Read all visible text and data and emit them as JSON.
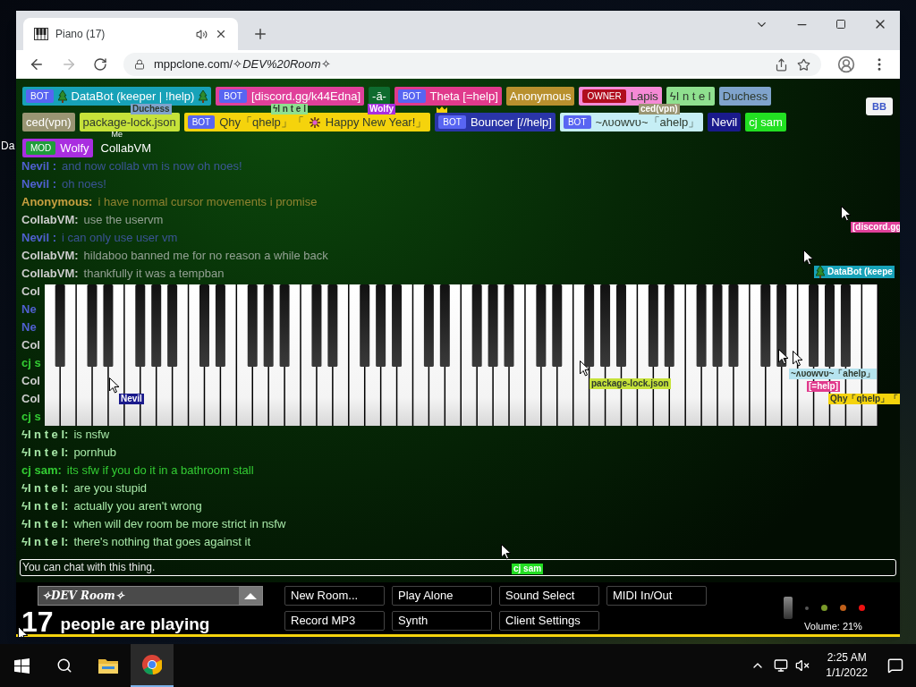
{
  "browser": {
    "tab_title": "Piano (17)",
    "address": "mppclone.com/✧*DEV%20Room*✧"
  },
  "desktop_fragment": "Da",
  "user_rows": [
    [
      {
        "color": "#17a2b8",
        "badge": {
          "text": "BOT",
          "color": "#5865f2"
        },
        "parts": [
          {
            "kind": "tree"
          },
          {
            "kind": "text",
            "text": "DataBot (keeper | !help)"
          },
          {
            "kind": "tree"
          }
        ]
      },
      {
        "color": "#e0409a",
        "badge": {
          "text": "BOT",
          "color": "#5865f2"
        },
        "parts": [
          {
            "kind": "text",
            "text": "[discord.gg/k44Edna]"
          }
        ]
      },
      {
        "color": "#0e6b2e",
        "parts": [
          {
            "kind": "text",
            "text": "-ā-"
          }
        ]
      },
      {
        "color": "#e03a8c",
        "badge": {
          "text": "BOT",
          "color": "#5865f2"
        },
        "parts": [
          {
            "kind": "text",
            "text": "Theta [=help]"
          }
        ]
      },
      {
        "color": "#b8902e",
        "parts": [
          {
            "kind": "text",
            "text": "Anonymous"
          }
        ]
      },
      {
        "color": "#f58ad6",
        "badge": {
          "text": "OWNER",
          "color": "#b00e1e"
        },
        "parts": [
          {
            "kind": "text",
            "text": "Lapis"
          }
        ]
      },
      {
        "color": "#8fe08f",
        "parts": [
          {
            "kind": "text",
            "text": "ϟI n t e l"
          }
        ]
      },
      {
        "color": "#7fa3cc",
        "parts": [
          {
            "kind": "text",
            "text": "Duchess"
          }
        ]
      }
    ],
    [
      {
        "color": "#9a9573",
        "parts": [
          {
            "kind": "text",
            "text": "ced(vpn)"
          }
        ]
      },
      {
        "color": "#c6e23a",
        "parts": [
          {
            "kind": "text",
            "text": "package-lock.json"
          }
        ]
      },
      {
        "color": "#f5d30c",
        "badge": {
          "text": "BOT",
          "color": "#5865f2"
        },
        "parts": [
          {
            "kind": "text",
            "text": "Qhy「qhelp」「"
          },
          {
            "kind": "firework"
          },
          {
            "kind": "text",
            "text": "Happy New Year!」"
          }
        ]
      },
      {
        "color": "#2a35a8",
        "crown": true,
        "badge": {
          "text": "BOT",
          "color": "#5865f2"
        },
        "parts": [
          {
            "kind": "text",
            "text": "Bouncer [//help]"
          }
        ]
      },
      {
        "color": "#c6eef5",
        "badge": {
          "text": "BOT",
          "color": "#5865f2"
        },
        "parts": [
          {
            "kind": "text",
            "text": "~ᴧᴜᴏᴡᴠᴜ~「ahelp」"
          }
        ]
      },
      {
        "color": "#1a1a8c",
        "parts": [
          {
            "kind": "text",
            "text": "Nevil"
          }
        ]
      },
      {
        "color": "#22e022",
        "parts": [
          {
            "kind": "text",
            "text": "cj sam"
          }
        ]
      }
    ],
    [
      {
        "color": "#a92ee0",
        "badge": {
          "text": "MOD",
          "color": "#1f9c3a"
        },
        "parts": [
          {
            "kind": "text",
            "text": "Wolfy"
          }
        ]
      },
      {
        "me": "Me",
        "parts": [
          {
            "kind": "text",
            "text": "CollabVM"
          }
        ]
      }
    ]
  ],
  "menu_button": "BB",
  "chat": [
    {
      "name": "Nevil :",
      "text": "and now collab vm is now oh noes!",
      "color": "#5060d0",
      "faded": true
    },
    {
      "name": "Nevil :",
      "text": "oh noes!",
      "color": "#5060d0",
      "faded": true
    },
    {
      "name": "Anonymous:",
      "text": "i have normal cursor movements i promise",
      "color": "#c8a040",
      "faded": true
    },
    {
      "name": "CollabVM:",
      "text": "use the uservm",
      "color": "#cccccc",
      "faded": true
    },
    {
      "name": "Nevil :",
      "text": "i can only use user vm",
      "color": "#5060d0",
      "faded": true
    },
    {
      "name": "CollabVM:",
      "text": "hildaboo banned me for no reason a while back",
      "color": "#cccccc",
      "faded": true
    },
    {
      "name": "CollabVM:",
      "text": "thankfully it was a tempban",
      "color": "#cccccc",
      "faded": true
    },
    {
      "name": "Col",
      "color": "#cccccc"
    },
    {
      "name": "Ne",
      "color": "#5060d0"
    },
    {
      "name": "Ne",
      "color": "#5060d0"
    },
    {
      "name": "Col",
      "color": "#cccccc"
    },
    {
      "name": "cj s",
      "color": "#33cc33"
    },
    {
      "name": "Col",
      "color": "#cccccc"
    },
    {
      "name": "Col",
      "color": "#cccccc"
    },
    {
      "name": "cj s",
      "color": "#33cc33"
    },
    {
      "name": "ϟI n t e l:",
      "text": "is nsfw",
      "color": "#a8e8a8",
      "faded": false
    },
    {
      "name": "ϟI n t e l:",
      "text": "pornhub",
      "color": "#a8e8a8",
      "faded": false
    },
    {
      "name": "cj sam:",
      "text": "its sfw if you do it in a bathroom stall",
      "color": "#33cc33",
      "faded": false
    },
    {
      "name": "ϟI n t e l:",
      "text": "are you stupid",
      "color": "#a8e8a8",
      "faded": false
    },
    {
      "name": "ϟI n t e l:",
      "text": "actually you aren't wrong",
      "color": "#a8e8a8",
      "faded": false
    },
    {
      "name": "ϟI n t e l:",
      "text": "when will dev room be more strict in nsfw",
      "color": "#a8e8a8",
      "faded": false
    },
    {
      "name": "ϟI n t e l:",
      "text": "there's nothing that goes against it",
      "color": "#a8e8a8",
      "faded": false
    }
  ],
  "cursors": [
    {
      "kind": "tag",
      "tag": "Duchess",
      "color": "#7fa3cc"
    },
    {
      "kind": "tag",
      "tag": "ϟI n t e l",
      "color": "#8fe08f"
    },
    {
      "kind": "tag",
      "tag": "Wolfy",
      "color": "#a92ee0"
    },
    {
      "kind": "tag",
      "tag": "ced(vpn)",
      "color": "#9a9573"
    },
    {
      "kind": "tagged",
      "tag": "[discord.gg",
      "color": "#e0409a"
    },
    {
      "kind": "tagged",
      "tag": "DataBot (keepe",
      "color": "#17a2b8",
      "tree": true
    },
    {
      "kind": "tagged",
      "tag": "package-lock.json",
      "color": "#c6e23a"
    },
    {
      "kind": "tagged",
      "tag": "Nevil",
      "color": "#1a1a8c"
    },
    {
      "kind": "tagged",
      "tag": "~ᴧᴜᴏᴡᴠᴜ~「ahelp」",
      "color": "#b6e3ef"
    },
    {
      "kind": "tagged",
      "tag": "[=help]",
      "color": "#e03a8c"
    },
    {
      "kind": "tag",
      "tag": "Qhy「qhelp」「",
      "color": "#f5d30c"
    },
    {
      "kind": "tagged",
      "tag": "cj sam",
      "color": "#22dd22"
    },
    {
      "kind": "arrow"
    }
  ],
  "chat_input": {
    "placeholder": "You can chat with this thing."
  },
  "room": "✧DEV Room✧",
  "player_count": "17",
  "player_label": "people are playing",
  "buttons": [
    "New Room...",
    "Play Alone",
    "Sound Select",
    "MIDI In/Out",
    "Record MP3",
    "Synth",
    "Client Settings"
  ],
  "lights": [
    {
      "color": "#555555"
    },
    {
      "color": "#7a9a2a"
    },
    {
      "color": "#c0601a"
    },
    {
      "color": "#ee1111"
    }
  ],
  "volume": "Volume: 21%",
  "taskbar": {
    "time": "2:25 AM",
    "date": "1/1/2022"
  }
}
